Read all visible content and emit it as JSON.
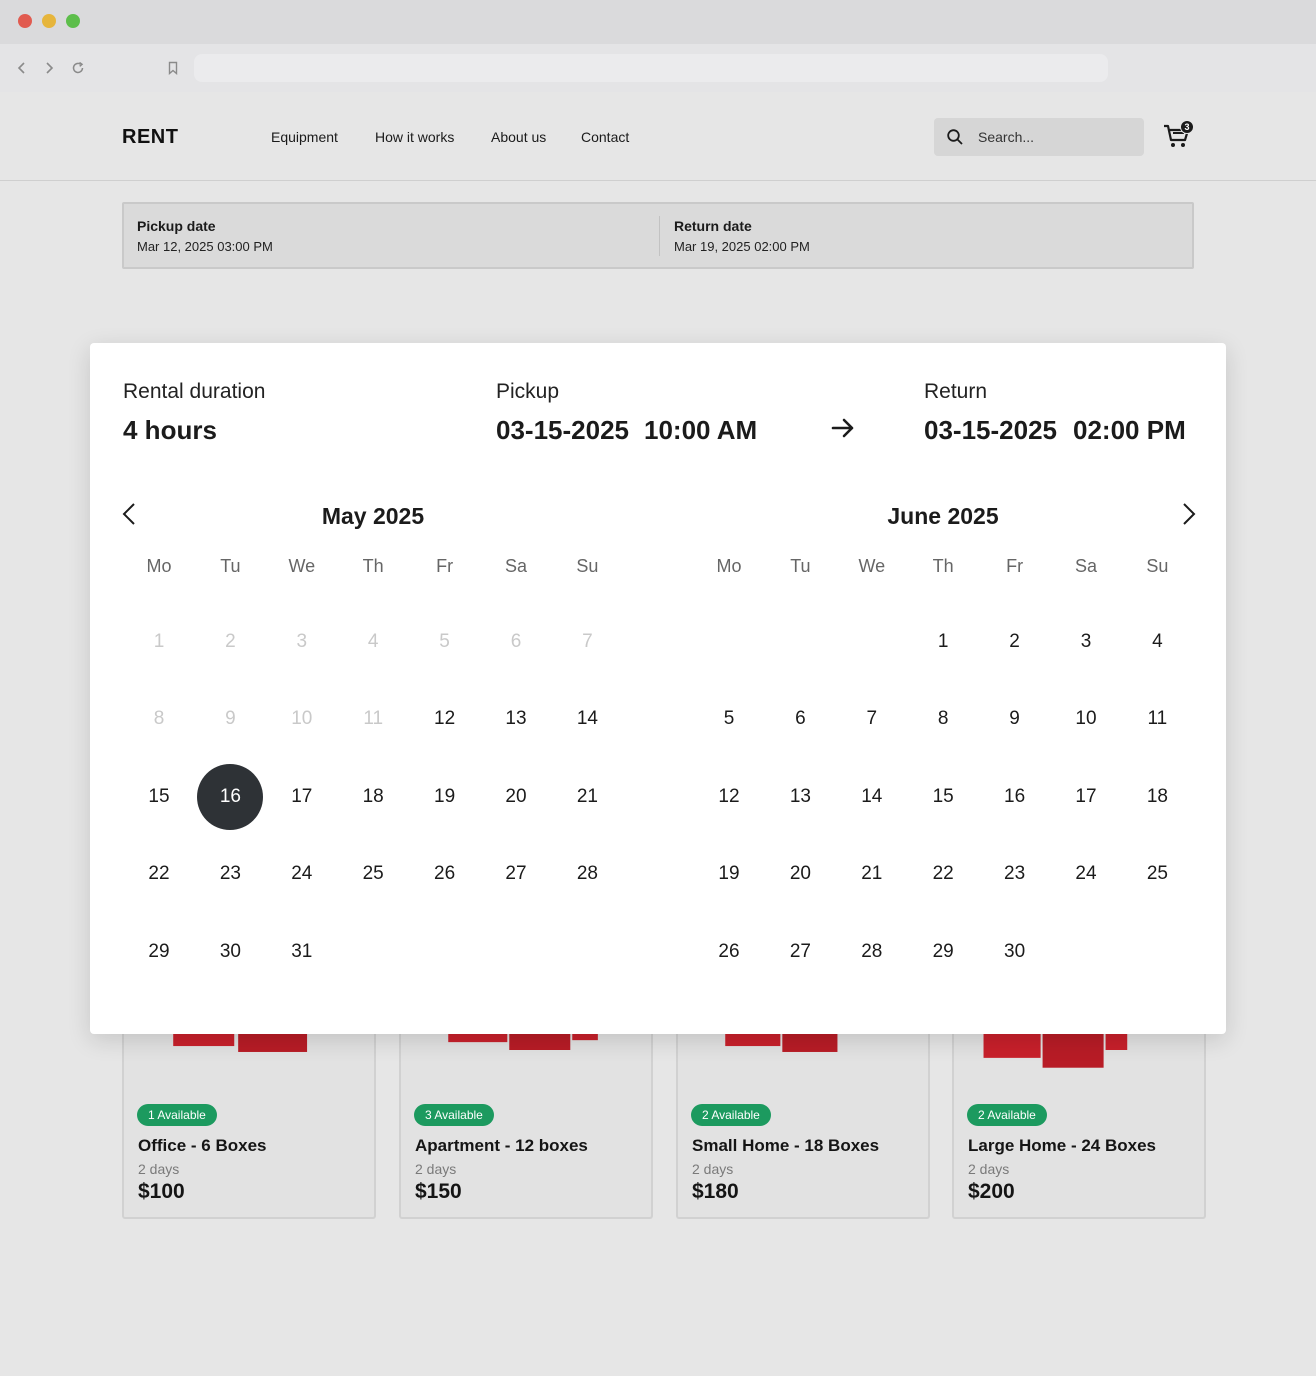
{
  "site": {
    "logo": "RENT",
    "nav": [
      "Equipment",
      "How it works",
      "About us",
      "Contact"
    ],
    "search_placeholder": "Search...",
    "cart_count": "3"
  },
  "booking_bar": {
    "pickup_label": "Pickup date",
    "pickup_value": "Mar 12, 2025 03:00 PM",
    "return_label": "Return date",
    "return_value": "Mar 19, 2025 02:00 PM"
  },
  "picker": {
    "duration_label": "Rental duration",
    "duration_value": "4 hours",
    "pickup_label": "Pickup",
    "pickup_date": "03-15-2025",
    "pickup_time": "10:00 AM",
    "return_label": "Return",
    "return_date": "03-15-2025",
    "return_time": "02:00 PM",
    "weekdays": [
      "Mo",
      "Tu",
      "We",
      "Th",
      "Fr",
      "Sa",
      "Su"
    ],
    "months": [
      {
        "title": "May 2025",
        "start_weekday_index": 0,
        "days": 31,
        "disabled_through": 11,
        "selected": 16
      },
      {
        "title": "June 2025",
        "start_weekday_index": 3,
        "days": 30,
        "disabled_through": 0,
        "selected": null
      }
    ]
  },
  "products": [
    {
      "badge": "1 Available",
      "name": "Office - 6 Boxes",
      "duration": "2 days",
      "price": "$100"
    },
    {
      "badge": "3 Available",
      "name": "Apartment - 12 boxes",
      "duration": "2 days",
      "price": "$150"
    },
    {
      "badge": "2 Available",
      "name": "Small Home - 18 Boxes",
      "duration": "2 days",
      "price": "$180"
    },
    {
      "badge": "2 Available",
      "name": "Large Home - 24 Boxes",
      "duration": "2 days",
      "price": "$200"
    }
  ],
  "colors": {
    "accent_badge": "#1c9a5f",
    "selected_day": "#2e3236",
    "box_red": "#c8202b"
  }
}
